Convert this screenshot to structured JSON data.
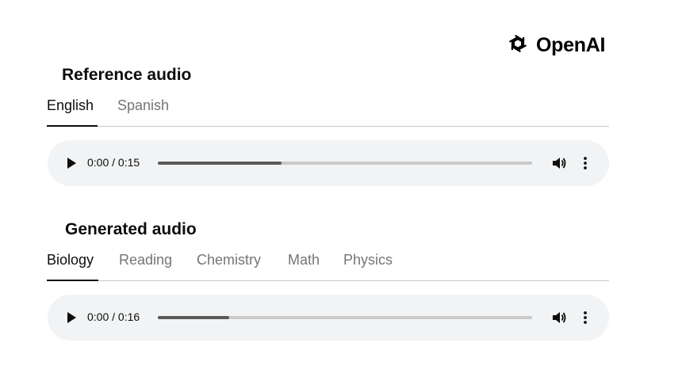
{
  "brand": {
    "name": "OpenAI",
    "icon": "openai-logo-icon"
  },
  "reference": {
    "heading": "Reference audio",
    "tabs": [
      {
        "label": "English",
        "active": true
      },
      {
        "label": "Spanish",
        "active": false
      }
    ],
    "player": {
      "time": "0:00 / 0:15",
      "progress_fraction": 0.33,
      "icons": [
        "play-icon",
        "volume-icon",
        "more-options-icon"
      ]
    }
  },
  "generated": {
    "heading": "Generated audio",
    "tabs": [
      {
        "label": "Biology",
        "active": true
      },
      {
        "label": "Reading",
        "active": false
      },
      {
        "label": "Chemistry",
        "active": false
      },
      {
        "label": "Math",
        "active": false
      },
      {
        "label": "Physics",
        "active": false
      }
    ],
    "player": {
      "time": "0:00 / 0:16",
      "progress_fraction": 0.19,
      "icons": [
        "play-icon",
        "volume-icon",
        "more-options-icon"
      ]
    }
  },
  "colors": {
    "player_bg": "#f1f3f4",
    "track": "#c9c9c9",
    "track_fill": "#5a5a5a",
    "inactive_tab": "#757575"
  }
}
